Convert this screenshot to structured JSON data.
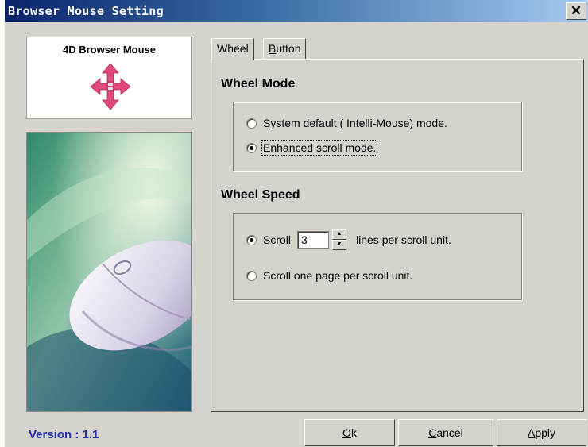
{
  "window": {
    "title": "Browser Mouse Setting",
    "close_glyph": "✕",
    "version_label": "Version : 1.1"
  },
  "logo": {
    "text": "4D Browser Mouse",
    "icon": "four-way-arrow-icon",
    "color": "#e0497e"
  },
  "tabs": [
    {
      "label": "Wheel",
      "active": true
    },
    {
      "label_underlined": "B",
      "label_rest": "utton",
      "active": false
    }
  ],
  "wheel_mode": {
    "title": "Wheel Mode",
    "options": [
      {
        "label": "System default ( Intelli-Mouse) mode.",
        "checked": false
      },
      {
        "label": "Enhanced scroll mode.",
        "checked": true
      }
    ]
  },
  "wheel_speed": {
    "title": "Wheel Speed",
    "scroll_prefix": "Scroll",
    "scroll_value": "3",
    "scroll_suffix": "lines per scroll unit.",
    "scroll_lines_checked": true,
    "page_option_label": "Scroll one page per scroll unit.",
    "page_option_checked": false
  },
  "buttons": [
    {
      "underlined": "O",
      "rest": "k"
    },
    {
      "underlined": "C",
      "rest": "ancel"
    },
    {
      "underlined": "A",
      "rest": "pply"
    }
  ],
  "colors": {
    "title_gradient_start": "#0a246a",
    "title_gradient_end": "#a6caf0",
    "dialog_face": "#d6d3ce",
    "version_text": "#1f2fa8"
  }
}
